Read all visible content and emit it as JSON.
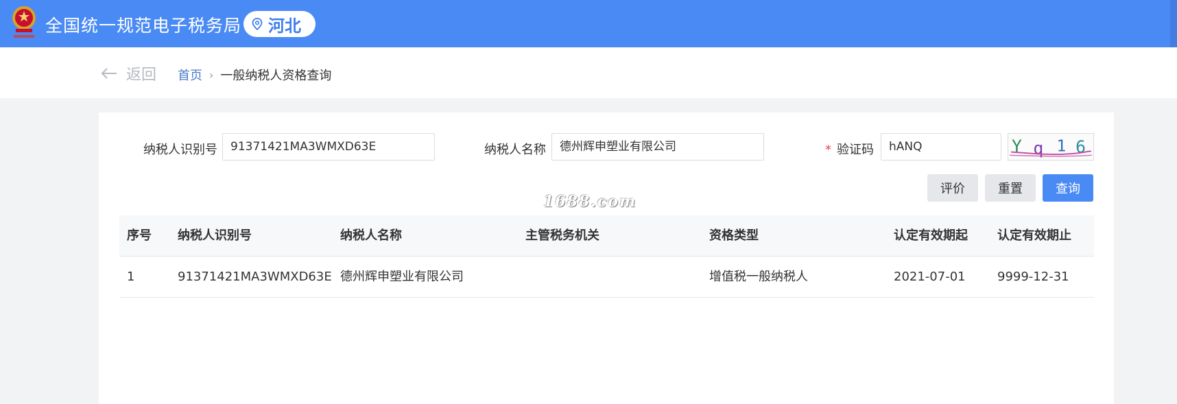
{
  "header": {
    "site_title": "全国统一规范电子税务局",
    "region": "河北",
    "brand_color": "#4a8af4"
  },
  "breadcrumb": {
    "back_label": "返回",
    "home": "首页",
    "separator": "›",
    "current": "一般纳税人资格查询"
  },
  "form": {
    "taxpayer_id_label": "纳税人识别号",
    "taxpayer_id_value": "91371421MA3WMXD63E",
    "taxpayer_name_label": "纳税人名称",
    "taxpayer_name_value": "德州辉申塑业有限公司",
    "required_mark": "*",
    "captcha_label": "验证码",
    "captcha_value": "hANQ",
    "captcha_chars": [
      "Y",
      "q",
      "1",
      "6"
    ]
  },
  "buttons": {
    "evaluate": "评价",
    "reset": "重置",
    "query": "查询"
  },
  "watermark": "1688.com",
  "table": {
    "headers": [
      "序号",
      "纳税人识别号",
      "纳税人名称",
      "主管税务机关",
      "资格类型",
      "认定有效期起",
      "认定有效期止"
    ],
    "rows": [
      [
        "1",
        "91371421MA3WMXD63E",
        "德州辉申塑业有限公司",
        "",
        "增值税一般纳税人",
        "2021-07-01",
        "9999-12-31"
      ]
    ]
  }
}
